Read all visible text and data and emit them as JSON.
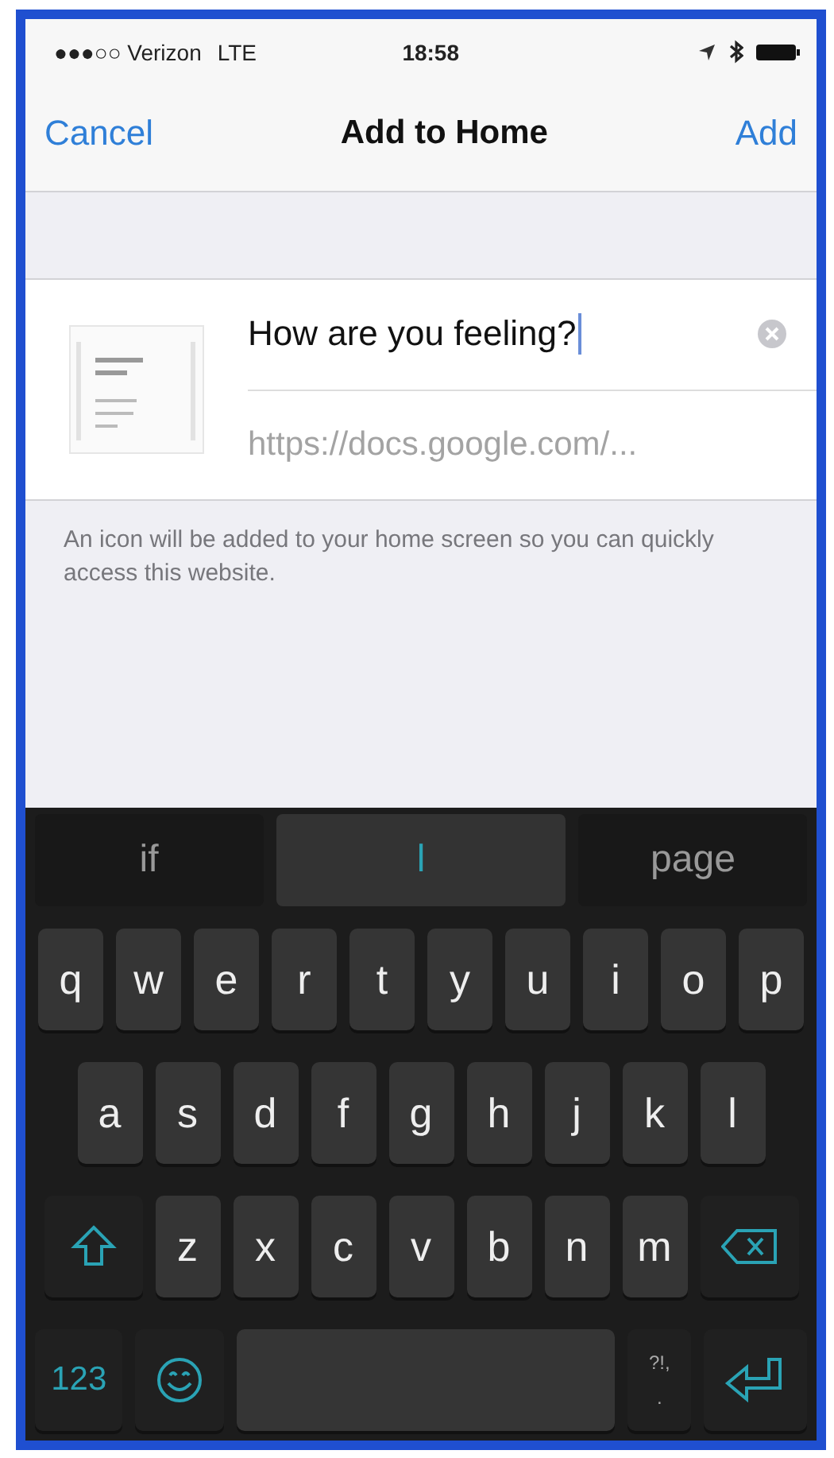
{
  "status_bar": {
    "carrier": "●●●○○ Verizon",
    "network": "LTE",
    "time": "18:58"
  },
  "nav_bar": {
    "cancel": "Cancel",
    "title": "Add to Home",
    "add": "Add"
  },
  "form": {
    "title_value": "How are you feeling?",
    "url": "https://docs.google.com/...",
    "note": "An icon will be added to your home screen so you can quickly access this website."
  },
  "suggestions": [
    {
      "label": "if",
      "selected": false
    },
    {
      "label": "l",
      "selected": true
    },
    {
      "label": "page",
      "selected": false
    }
  ],
  "keyboard_rows": [
    [
      {
        "kind": "letter",
        "label": "q"
      },
      {
        "kind": "letter",
        "label": "w"
      },
      {
        "kind": "letter",
        "label": "e"
      },
      {
        "kind": "letter",
        "label": "r"
      },
      {
        "kind": "letter",
        "label": "t"
      },
      {
        "kind": "letter",
        "label": "y"
      },
      {
        "kind": "letter",
        "label": "u"
      },
      {
        "kind": "letter",
        "label": "i"
      },
      {
        "kind": "letter",
        "label": "o"
      },
      {
        "kind": "letter",
        "label": "p"
      }
    ],
    [
      {
        "kind": "letter",
        "label": "a"
      },
      {
        "kind": "letter",
        "label": "s"
      },
      {
        "kind": "letter",
        "label": "d"
      },
      {
        "kind": "letter",
        "label": "f"
      },
      {
        "kind": "letter",
        "label": "g"
      },
      {
        "kind": "letter",
        "label": "h"
      },
      {
        "kind": "letter",
        "label": "j"
      },
      {
        "kind": "letter",
        "label": "k"
      },
      {
        "kind": "letter",
        "label": "l"
      }
    ],
    [
      {
        "kind": "shift"
      },
      {
        "kind": "letter",
        "label": "z"
      },
      {
        "kind": "letter",
        "label": "x"
      },
      {
        "kind": "letter",
        "label": "c"
      },
      {
        "kind": "letter",
        "label": "v"
      },
      {
        "kind": "letter",
        "label": "b"
      },
      {
        "kind": "letter",
        "label": "n"
      },
      {
        "kind": "letter",
        "label": "m"
      },
      {
        "kind": "delete"
      }
    ],
    [
      {
        "kind": "numbers",
        "label": "123"
      },
      {
        "kind": "emoji"
      },
      {
        "kind": "space"
      },
      {
        "kind": "punct",
        "label": "?!,",
        "sub": "."
      },
      {
        "kind": "return"
      }
    ]
  ]
}
